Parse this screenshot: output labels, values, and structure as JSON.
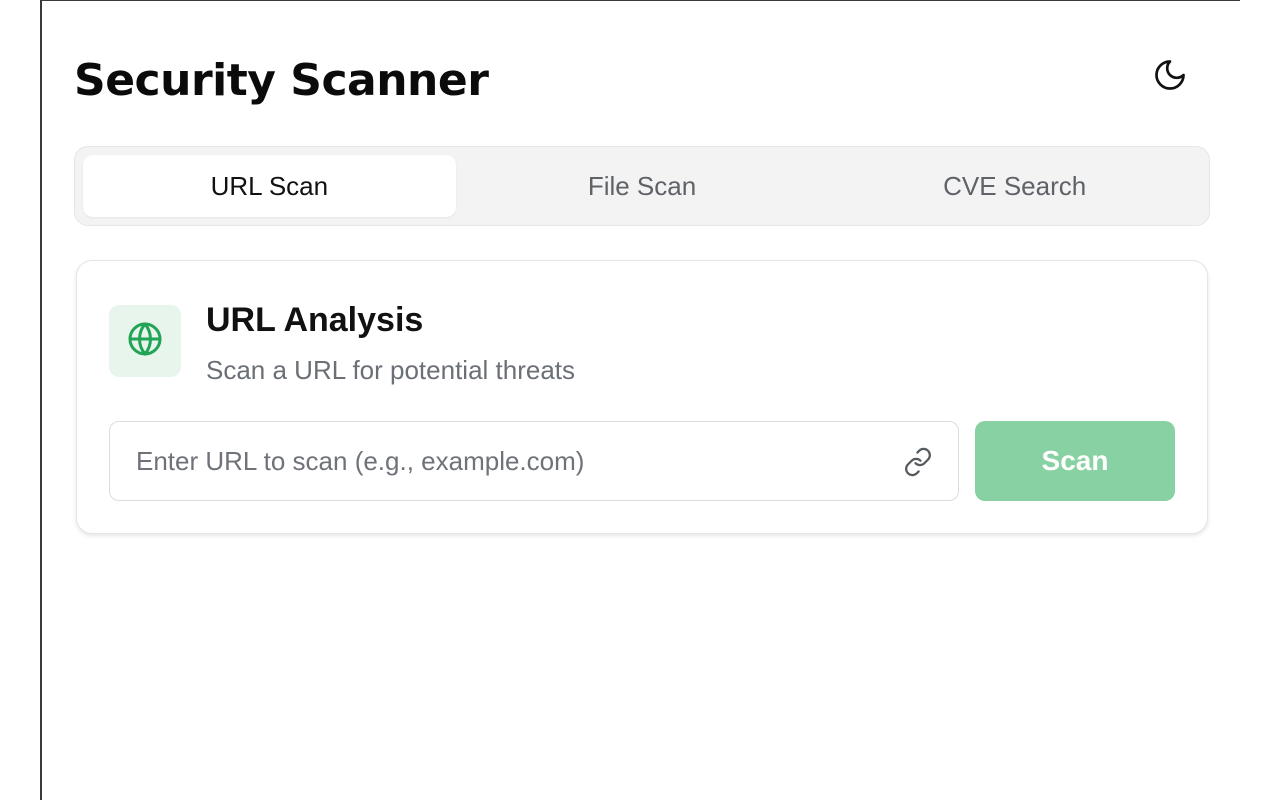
{
  "app": {
    "title": "Security Scanner"
  },
  "header": {
    "theme_toggle_icon": "moon-icon"
  },
  "tabs": [
    {
      "label": "URL Scan",
      "active": true
    },
    {
      "label": "File Scan",
      "active": false
    },
    {
      "label": "CVE Search",
      "active": false
    }
  ],
  "card": {
    "icon": "globe-icon",
    "title": "URL Analysis",
    "subtitle": "Scan a URL for potential threats",
    "url_input": {
      "value": "",
      "placeholder": "Enter URL to scan (e.g., example.com)",
      "icon": "link-icon"
    },
    "scan_button_label": "Scan"
  },
  "colors": {
    "accent": "#22a355",
    "accent_soft_bg": "#e8f5ec",
    "button_bg": "#88d1a2",
    "tab_bar_bg": "#f3f3f3"
  }
}
